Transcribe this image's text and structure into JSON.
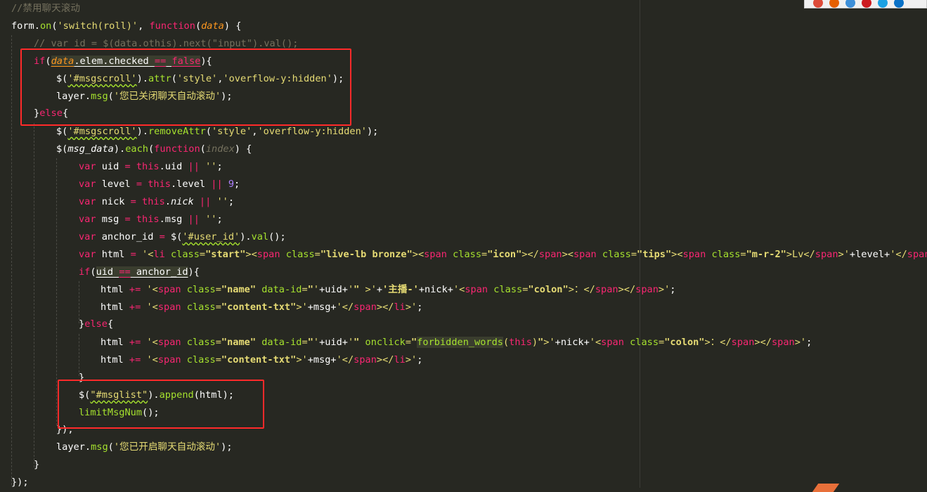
{
  "editor": {
    "lines": [
      [
        [
          "//禁用聊天滚动",
          "comment"
        ]
      ],
      [
        [
          "form",
          "plain"
        ],
        [
          ".",
          "plain"
        ],
        [
          "on",
          "fn"
        ],
        [
          "(",
          "plain"
        ],
        [
          "'switch(roll)'",
          "str"
        ],
        [
          ", ",
          "plain"
        ],
        [
          "function",
          "kw"
        ],
        [
          "(",
          "plain"
        ],
        [
          "data",
          "param"
        ],
        [
          ") {",
          "plain"
        ]
      ],
      [
        [
          "// var id = $(data.othis).next(\"input\").val();",
          "comment"
        ]
      ],
      [
        [
          "if",
          "kw"
        ],
        [
          "(",
          "plain"
        ],
        [
          "data",
          "param-ul"
        ],
        [
          ".elem.checked ",
          "plain-ul"
        ],
        [
          "==",
          "kw-ul"
        ],
        [
          " ",
          "plain-ul"
        ],
        [
          "false",
          "kw-ul"
        ],
        [
          "){",
          "plain"
        ]
      ],
      [
        [
          "$(",
          "plain"
        ],
        [
          "'#msgscroll'",
          "str-wavy"
        ],
        [
          ").",
          "plain"
        ],
        [
          "attr",
          "fn"
        ],
        [
          "(",
          "plain"
        ],
        [
          "'style'",
          "str"
        ],
        [
          ",",
          "plain"
        ],
        [
          "'overflow-y:hidden'",
          "str"
        ],
        [
          ");",
          "plain"
        ]
      ],
      [
        [
          "layer",
          "plain"
        ],
        [
          ".",
          "plain"
        ],
        [
          "msg",
          "fn"
        ],
        [
          "(",
          "plain"
        ],
        [
          "'您已关闭聊天自动滚动'",
          "str"
        ],
        [
          ");",
          "plain"
        ]
      ],
      [
        [
          "}",
          "plain"
        ],
        [
          "else",
          "kw"
        ],
        [
          "{",
          "plain"
        ]
      ],
      [
        [
          "$(",
          "plain"
        ],
        [
          "'#msgscroll'",
          "str-wavy"
        ],
        [
          ").",
          "plain"
        ],
        [
          "removeAttr",
          "fn"
        ],
        [
          "(",
          "plain"
        ],
        [
          "'style'",
          "str"
        ],
        [
          ",",
          "plain"
        ],
        [
          "'overflow-y:hidden'",
          "str"
        ],
        [
          ");",
          "plain"
        ]
      ],
      [
        [
          "$(",
          "plain"
        ],
        [
          "msg_data",
          "italic"
        ],
        [
          ").",
          "plain"
        ],
        [
          "each",
          "fn"
        ],
        [
          "(",
          "plain"
        ],
        [
          "function",
          "kw"
        ],
        [
          "(",
          "plain"
        ],
        [
          "index",
          "comment-italic"
        ],
        [
          ") {",
          "plain"
        ]
      ],
      [
        [
          "var",
          "kw"
        ],
        [
          " uid ",
          "plain"
        ],
        [
          "=",
          "kw"
        ],
        [
          " ",
          "plain"
        ],
        [
          "this",
          "kw"
        ],
        [
          ".uid ",
          "plain"
        ],
        [
          "||",
          "kw"
        ],
        [
          " ",
          "plain"
        ],
        [
          "''",
          "str"
        ],
        [
          ";",
          "plain"
        ]
      ],
      [
        [
          "var",
          "kw"
        ],
        [
          " level ",
          "plain"
        ],
        [
          "=",
          "kw"
        ],
        [
          " ",
          "plain"
        ],
        [
          "this",
          "kw"
        ],
        [
          ".level ",
          "plain"
        ],
        [
          "||",
          "kw"
        ],
        [
          " ",
          "plain"
        ],
        [
          "9",
          "num"
        ],
        [
          ";",
          "plain"
        ]
      ],
      [
        [
          "var",
          "kw"
        ],
        [
          " nick ",
          "plain"
        ],
        [
          "=",
          "kw"
        ],
        [
          " ",
          "plain"
        ],
        [
          "this",
          "kw"
        ],
        [
          ".",
          "plain"
        ],
        [
          "nick",
          "italic"
        ],
        [
          " ",
          "plain"
        ],
        [
          "||",
          "kw"
        ],
        [
          " ",
          "plain"
        ],
        [
          "''",
          "str"
        ],
        [
          ";",
          "plain"
        ]
      ],
      [
        [
          "var",
          "kw"
        ],
        [
          " msg ",
          "plain"
        ],
        [
          "=",
          "kw"
        ],
        [
          " ",
          "plain"
        ],
        [
          "this",
          "kw"
        ],
        [
          ".msg ",
          "plain"
        ],
        [
          "||",
          "kw"
        ],
        [
          " ",
          "plain"
        ],
        [
          "''",
          "str"
        ],
        [
          ";",
          "plain"
        ]
      ],
      [
        [
          "var",
          "kw"
        ],
        [
          " anchor_id ",
          "plain"
        ],
        [
          "=",
          "kw"
        ],
        [
          " $(",
          "plain"
        ],
        [
          "'#user_id'",
          "str-wavy"
        ],
        [
          ").",
          "plain"
        ],
        [
          "val",
          "fn"
        ],
        [
          "();",
          "plain"
        ]
      ],
      [
        [
          "var",
          "kw"
        ],
        [
          " html ",
          "plain"
        ],
        [
          "=",
          "kw"
        ],
        [
          " ",
          "plain"
        ],
        [
          "'<",
          "str"
        ],
        [
          "li",
          "kw"
        ],
        [
          " ",
          "str"
        ],
        [
          "class",
          "fn"
        ],
        [
          "=",
          "str"
        ],
        [
          "\"start\"",
          "str-bold"
        ],
        [
          ">",
          "str"
        ],
        [
          "<",
          "str"
        ],
        [
          "span",
          "kw"
        ],
        [
          " ",
          "str"
        ],
        [
          "class",
          "fn"
        ],
        [
          "=",
          "str"
        ],
        [
          "\"live-lb bronze\"",
          "str-bold"
        ],
        [
          ">",
          "str"
        ],
        [
          "<",
          "str"
        ],
        [
          "span",
          "kw"
        ],
        [
          " ",
          "str"
        ],
        [
          "class",
          "fn"
        ],
        [
          "=",
          "str"
        ],
        [
          "\"icon\"",
          "str-bold"
        ],
        [
          "></",
          "str"
        ],
        [
          "span",
          "kw"
        ],
        [
          "><",
          "str"
        ],
        [
          "span",
          "kw"
        ],
        [
          " ",
          "str"
        ],
        [
          "class",
          "fn"
        ],
        [
          "=",
          "str"
        ],
        [
          "\"tips\"",
          "str-bold"
        ],
        [
          "><",
          "str"
        ],
        [
          "span",
          "kw"
        ],
        [
          " ",
          "str"
        ],
        [
          "class",
          "fn"
        ],
        [
          "=",
          "str"
        ],
        [
          "\"m-r-2\"",
          "str-bold"
        ],
        [
          ">Lv</",
          "str"
        ],
        [
          "span",
          "kw"
        ],
        [
          ">'",
          "str"
        ],
        [
          "+level+",
          "plain"
        ],
        [
          "'</",
          "str"
        ],
        [
          "span",
          "kw"
        ],
        [
          "></",
          "str"
        ]
      ],
      [
        [
          "if",
          "kw"
        ],
        [
          "(",
          "plain"
        ],
        [
          "uid ",
          "plain-ul-hl"
        ],
        [
          "==",
          "kw-ul-hl"
        ],
        [
          " anchor_id",
          "plain-ul-hl"
        ],
        [
          "){",
          "plain"
        ]
      ],
      [
        [
          "html ",
          "plain"
        ],
        [
          "+=",
          "kw"
        ],
        [
          " ",
          "plain"
        ],
        [
          "'<",
          "str"
        ],
        [
          "span",
          "kw"
        ],
        [
          " ",
          "str"
        ],
        [
          "class",
          "fn"
        ],
        [
          "=",
          "str"
        ],
        [
          "\"name\"",
          "str-bold"
        ],
        [
          " ",
          "str"
        ],
        [
          "data-id",
          "fn"
        ],
        [
          "=",
          "str"
        ],
        [
          "\"",
          "str-bold"
        ],
        [
          "'",
          "str"
        ],
        [
          "+uid+",
          "plain"
        ],
        [
          "'",
          "str"
        ],
        [
          "\"",
          "str-bold"
        ],
        [
          " >'",
          "str"
        ],
        [
          "+",
          "plain"
        ],
        [
          "'主播-'",
          "str-bold"
        ],
        [
          "+nick+",
          "plain"
        ],
        [
          "'<",
          "str"
        ],
        [
          "span",
          "kw"
        ],
        [
          " ",
          "str"
        ],
        [
          "class",
          "fn"
        ],
        [
          "=",
          "str"
        ],
        [
          "\"colon\"",
          "str-bold"
        ],
        [
          ">：</",
          "str"
        ],
        [
          "span",
          "kw"
        ],
        [
          "></",
          "str"
        ],
        [
          "span",
          "kw"
        ],
        [
          ">'",
          "str"
        ],
        [
          ";",
          "plain"
        ]
      ],
      [
        [
          "html ",
          "plain"
        ],
        [
          "+=",
          "kw"
        ],
        [
          " ",
          "plain"
        ],
        [
          "'<",
          "str"
        ],
        [
          "span",
          "kw"
        ],
        [
          " ",
          "str"
        ],
        [
          "class",
          "fn"
        ],
        [
          "=",
          "str"
        ],
        [
          "\"content-txt\"",
          "str-bold"
        ],
        [
          ">'",
          "str"
        ],
        [
          "+msg+",
          "plain"
        ],
        [
          "'</",
          "str"
        ],
        [
          "span",
          "kw"
        ],
        [
          "></",
          "str"
        ],
        [
          "li",
          "kw"
        ],
        [
          ">'",
          "str"
        ],
        [
          ";",
          "plain"
        ]
      ],
      [
        [
          "}",
          "plain"
        ],
        [
          "else",
          "kw"
        ],
        [
          "{",
          "plain"
        ]
      ],
      [
        [
          "html ",
          "plain"
        ],
        [
          "+=",
          "kw"
        ],
        [
          " ",
          "plain"
        ],
        [
          "'<",
          "str"
        ],
        [
          "span",
          "kw"
        ],
        [
          " ",
          "str"
        ],
        [
          "class",
          "fn"
        ],
        [
          "=",
          "str"
        ],
        [
          "\"name\"",
          "str-bold"
        ],
        [
          " ",
          "str"
        ],
        [
          "data-id",
          "fn"
        ],
        [
          "=",
          "str"
        ],
        [
          "\"",
          "str-bold"
        ],
        [
          "'",
          "str"
        ],
        [
          "+uid+",
          "plain"
        ],
        [
          "'",
          "str"
        ],
        [
          "\"",
          "str-bold"
        ],
        [
          " ",
          "str"
        ],
        [
          "onclick",
          "fn"
        ],
        [
          "=",
          "str"
        ],
        [
          "\"",
          "str-bold"
        ],
        [
          "forbidden_words",
          "fn-hl"
        ],
        [
          "(",
          "str"
        ],
        [
          "this",
          "kw"
        ],
        [
          ")",
          "str"
        ],
        [
          "\"",
          "str-bold"
        ],
        [
          ">'",
          "str"
        ],
        [
          "+nick+",
          "plain"
        ],
        [
          "'<",
          "str"
        ],
        [
          "span",
          "kw"
        ],
        [
          " ",
          "str"
        ],
        [
          "class",
          "fn"
        ],
        [
          "=",
          "str"
        ],
        [
          "\"colon\"",
          "str-bold"
        ],
        [
          ">：</",
          "str"
        ],
        [
          "span",
          "kw"
        ],
        [
          "></",
          "str"
        ],
        [
          "span",
          "kw"
        ],
        [
          ">'",
          "str"
        ],
        [
          ";",
          "plain"
        ]
      ],
      [
        [
          "html ",
          "plain"
        ],
        [
          "+=",
          "kw"
        ],
        [
          " ",
          "plain"
        ],
        [
          "'<",
          "str"
        ],
        [
          "span",
          "kw"
        ],
        [
          " ",
          "str"
        ],
        [
          "class",
          "fn"
        ],
        [
          "=",
          "str"
        ],
        [
          "\"content-txt\"",
          "str-bold"
        ],
        [
          ">'",
          "str"
        ],
        [
          "+msg+",
          "plain"
        ],
        [
          "'</",
          "str"
        ],
        [
          "span",
          "kw"
        ],
        [
          "></",
          "str"
        ],
        [
          "li",
          "kw"
        ],
        [
          ">'",
          "str"
        ],
        [
          ";",
          "plain"
        ]
      ],
      [
        [
          "}",
          "plain"
        ]
      ],
      [
        [
          "$(",
          "plain"
        ],
        [
          "\"#msglist\"",
          "str-wavy"
        ],
        [
          ").",
          "plain"
        ],
        [
          "append",
          "fn"
        ],
        [
          "(html);",
          "plain"
        ]
      ],
      [
        [
          "limitMsgNum",
          "fn"
        ],
        [
          "();",
          "plain"
        ]
      ],
      [
        [
          "});",
          "plain"
        ]
      ],
      [
        [
          "layer",
          "plain"
        ],
        [
          ".",
          "plain"
        ],
        [
          "msg",
          "fn"
        ],
        [
          "(",
          "plain"
        ],
        [
          "'您已开启聊天自动滚动'",
          "str"
        ],
        [
          ");",
          "plain"
        ]
      ],
      [
        [
          "}",
          "plain"
        ]
      ],
      [
        [
          "});",
          "plain"
        ]
      ]
    ]
  },
  "colors": {
    "background": "#272822",
    "keyword": "#f92672",
    "string": "#e6db74",
    "function": "#a6e22e",
    "comment": "#75715e",
    "number": "#ae81ff",
    "highlight_box": "#ff2a2a"
  },
  "browser_icons": [
    {
      "icon": "chrome-icon",
      "color": "#dd4b39"
    },
    {
      "icon": "firefox-icon",
      "color": "#e66000"
    },
    {
      "icon": "safari-icon",
      "color": "#3d8fd8"
    },
    {
      "icon": "opera-icon",
      "color": "#cc1b20"
    },
    {
      "icon": "ie-icon",
      "color": "#1ba1e2"
    },
    {
      "icon": "edge-icon",
      "color": "#0b72c7"
    }
  ]
}
